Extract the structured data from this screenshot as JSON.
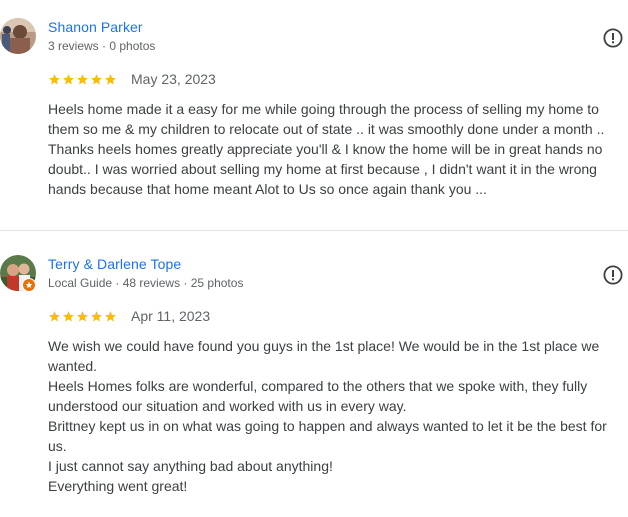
{
  "reviews": [
    {
      "reviewer_name": "Shanon Parker",
      "meta": "3 reviews · 0 photos",
      "rating": 5,
      "date": "May 23, 2023",
      "text": "Heels home made it a easy for me while going through the process of selling my home to them so me & my children to relocate out of state .. it was smoothly done under a month .. Thanks heels homes greatly appreciate you'll & I know the home will be in great hands no doubt.. I was worried about selling my home at first because , I didn't want it in the wrong hands because that home meant Alot to Us so once again thank you ..."
    },
    {
      "reviewer_name": "Terry & Darlene Tope",
      "meta": "Local Guide · 48 reviews · 25 photos",
      "rating": 5,
      "date": "Apr 11, 2023",
      "text": "We wish we could have found you guys in the 1st place! We would be in the 1st place we wanted.\nHeels Homes folks are wonderful, compared to the others that we spoke with, they fully understood our situation and worked with us in every way.\nBrittney kept us in on what was going to happen and always wanted to let it be the best for us.\nI just cannot say anything bad about anything!\nEverything went great!"
    }
  ],
  "icons": {
    "star": "star-icon",
    "report": "report-icon",
    "local_guide_badge": "local-guide-badge-icon"
  },
  "colors": {
    "name_link": "#1a73e8",
    "star": "#fbbc04",
    "meta_text": "#5f6368",
    "body_text": "#3c4043",
    "local_guide_badge": "#e8710a"
  }
}
